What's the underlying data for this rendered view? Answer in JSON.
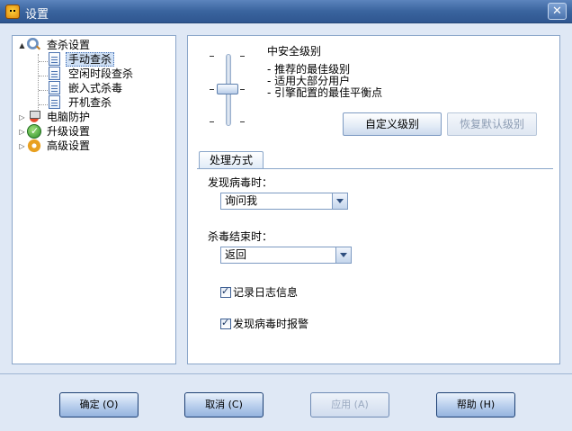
{
  "window": {
    "title": "设置",
    "close_label": "✕"
  },
  "tree": {
    "root": {
      "label": "查杀设置",
      "expander": "▲"
    },
    "children": [
      {
        "label": "手动查杀",
        "selected": true
      },
      {
        "label": "空闲时段查杀"
      },
      {
        "label": "嵌入式杀毒"
      },
      {
        "label": "开机查杀"
      }
    ],
    "others": [
      {
        "label": "电脑防护",
        "expander": "▷",
        "icon": "computer-protect-icon"
      },
      {
        "label": "升级设置",
        "expander": "▷",
        "icon": "upgrade-icon"
      },
      {
        "label": "高级设置",
        "expander": "▷",
        "icon": "advanced-settings-icon"
      }
    ]
  },
  "security_level": {
    "title": "中安全级别",
    "descriptions": [
      "- 推荐的最佳级别",
      "- 适用大部分用户",
      "- 引擎配置的最佳平衡点"
    ],
    "custom_button": "自定义级别",
    "restore_button": "恢复默认级别"
  },
  "handling": {
    "tab_label": "处理方式",
    "virus_found_label": "发现病毒时：",
    "virus_found_value": "询问我",
    "scan_end_label": "杀毒结束时：",
    "scan_end_value": "返回",
    "log_label": "记录日志信息",
    "log_checked": true,
    "alarm_label": "发现病毒时报警",
    "alarm_checked": true
  },
  "footer": {
    "ok": "确定 (O)",
    "cancel": "取消 (C)",
    "apply": "应用 (A)",
    "help": "帮助 (H)"
  }
}
